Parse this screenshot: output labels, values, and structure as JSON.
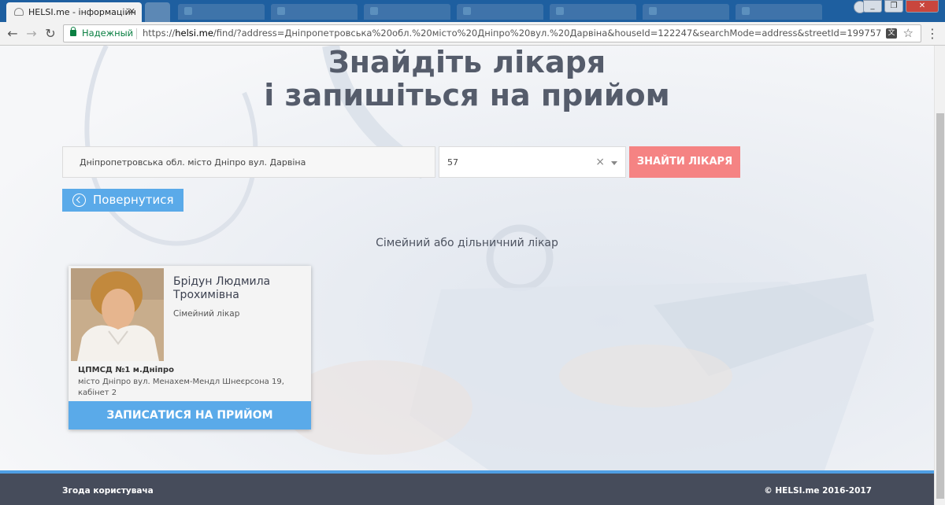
{
  "browser": {
    "active_tab": {
      "title": "HELSI.me - інформаційн"
    },
    "address_bar": {
      "secure_label": "Надежный",
      "url_scheme": "https://",
      "url_host": "helsi.me",
      "url_rest": "/find/?address=Дніпропетровська%20обл.%20місто%20Дніпро%20вул.%20Дарвіна&houseId=122247&searchMode=address&streetId=199757"
    },
    "icons": [
      "back-icon",
      "forward-icon",
      "reload-icon",
      "lock-icon",
      "translate-icon",
      "star-icon",
      "menu-icon"
    ]
  },
  "page": {
    "headline_line1": "Знайдіть лікаря",
    "headline_line2": "і запишіться на прийом",
    "search": {
      "address_value": "Дніпропетровська обл. місто Дніпро вул. Дарвіна",
      "house_value": "57",
      "clear_symbol": "×",
      "find_button": "ЗНАЙТИ ЛІКАРЯ"
    },
    "back_button": "Повернутися",
    "section_title": "Сімейний або дільничний лікар",
    "doctors": [
      {
        "name_line1": "Брідун Людмила",
        "name_line2": "Трохимівна",
        "role": "Сімейний лікар",
        "clinic": "ЦПМСД №1 м.Дніпро",
        "address": "місто Дніпро вул. Менахем-Мендл Шнеєрсона 19, кабінет 2",
        "book_button": "ЗАПИСАТИСЯ НА ПРИЙОМ"
      }
    ],
    "footer": {
      "left": "Згода користувача",
      "right": "© HELSI.me 2016-2017"
    }
  },
  "colors": {
    "title_text": "#555c6b",
    "find_button": "#f58383",
    "primary_blue": "#5aaae9",
    "footer_bg": "#464c5b",
    "tabstrip": "#1e5fa0"
  }
}
